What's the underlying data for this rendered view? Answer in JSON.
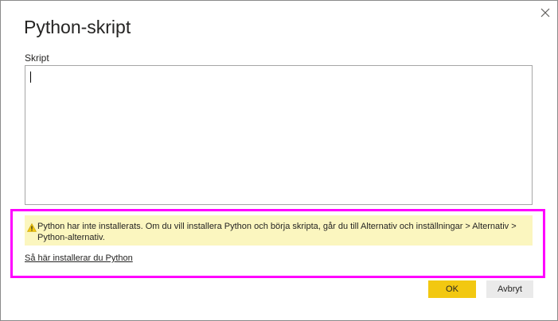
{
  "dialog": {
    "title": "Python-skript",
    "close_icon": "close-icon"
  },
  "script": {
    "label": "Skript",
    "value": ""
  },
  "warning": {
    "icon": "warning-icon",
    "text": "Python har inte installerats. Om du vill installera Python och börja skripta, går du till Alternativ och inställningar > Alternativ > Python-alternativ."
  },
  "link": {
    "install_label": "Så här installerar du Python"
  },
  "buttons": {
    "ok_label": "OK",
    "cancel_label": "Avbryt"
  },
  "colors": {
    "ok_button": "#f2c811",
    "warning_background": "#fbf6bf",
    "highlight_border": "#ff00ff"
  }
}
